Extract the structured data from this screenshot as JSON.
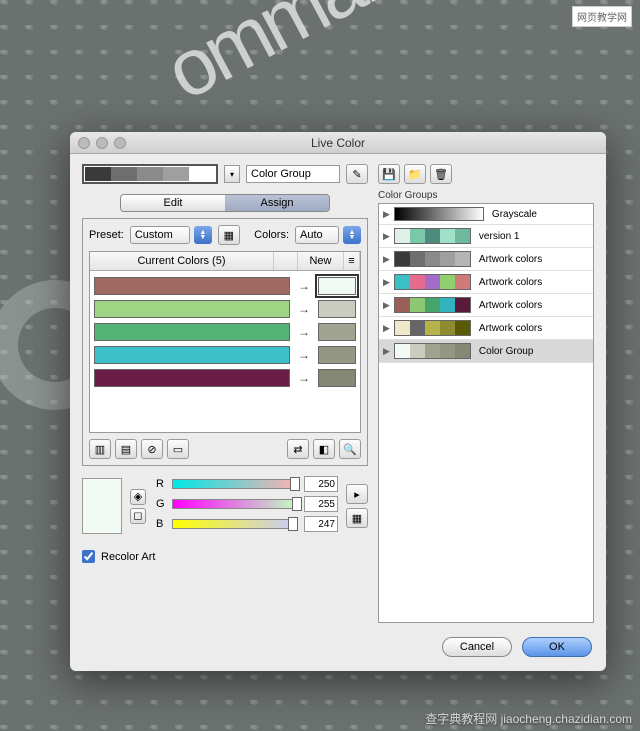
{
  "watermarks": {
    "top": "网页教学网",
    "bottom": "查字典教程网 jiaocheng.chazidian.com"
  },
  "dialog": {
    "title": "Live Color",
    "group_name": "Color Group",
    "tabs": {
      "edit": "Edit",
      "assign": "Assign",
      "active": "assign"
    },
    "preset_label": "Preset:",
    "preset_value": "Custom",
    "colors_label": "Colors:",
    "colors_value": "Auto",
    "list_header_current": "Current Colors (5)",
    "list_header_new": "New",
    "rows": [
      {
        "current": "#a06a62",
        "new": "#f1fbf3",
        "selected": true
      },
      {
        "current": "#9fd484",
        "new": "#c9ccbf",
        "selected": false
      },
      {
        "current": "#53b375",
        "new": "#a0a390",
        "selected": false
      },
      {
        "current": "#3ebfc9",
        "new": "#949784",
        "selected": false
      },
      {
        "current": "#6a1d45",
        "new": "#858875",
        "selected": false
      }
    ],
    "mini_swatches": [
      "#3a3a3a",
      "#6e6e6e",
      "#8a8a8a",
      "#9f9f9f",
      "#ffffff"
    ],
    "sliders": {
      "r": 250,
      "g": 255,
      "b": 247,
      "r_grad": "linear-gradient(90deg,#00e7e7,#ffb0b0)",
      "g_grad": "linear-gradient(90deg,#ff00ff,#c0ffc0)",
      "b_grad": "linear-gradient(90deg,#ffff00,#c8c8ff)"
    },
    "recolor_label": "Recolor Art",
    "recolor_checked": true,
    "color_groups_label": "Color Groups",
    "groups": [
      {
        "label": "Grayscale",
        "swatches": [
          "#000",
          "#2b2b2b",
          "#555",
          "#808080",
          "#aaa",
          "#d5d5d5"
        ],
        "grad": true
      },
      {
        "label": "version 1",
        "swatches": [
          "#dff0e8",
          "#79c9a9",
          "#4c8b7e",
          "#9fe2c9",
          "#6fb89b"
        ]
      },
      {
        "label": "Artwork colors",
        "swatches": [
          "#3a3a3a",
          "#6e6e6e",
          "#8a8a8a",
          "#9f9f9f",
          "#b5b5b5"
        ]
      },
      {
        "label": "Artwork colors",
        "swatches": [
          "#3bc0c6",
          "#e76b8f",
          "#a46cc9",
          "#8fcf6d",
          "#d07a7a"
        ]
      },
      {
        "label": "Artwork colors",
        "swatches": [
          "#9a5f57",
          "#8cc772",
          "#45a56a",
          "#32b3bd",
          "#5a1a3b"
        ]
      },
      {
        "label": "Artwork colors",
        "swatches": [
          "#efe9c9",
          "#666",
          "#b5b24a",
          "#8c8c2e",
          "#5a5a00"
        ]
      },
      {
        "label": "Color Group",
        "swatches": [
          "#f1fbf3",
          "#c9ccbf",
          "#a0a390",
          "#949784",
          "#858875"
        ],
        "selected": true
      }
    ],
    "buttons": {
      "cancel": "Cancel",
      "ok": "OK"
    }
  }
}
